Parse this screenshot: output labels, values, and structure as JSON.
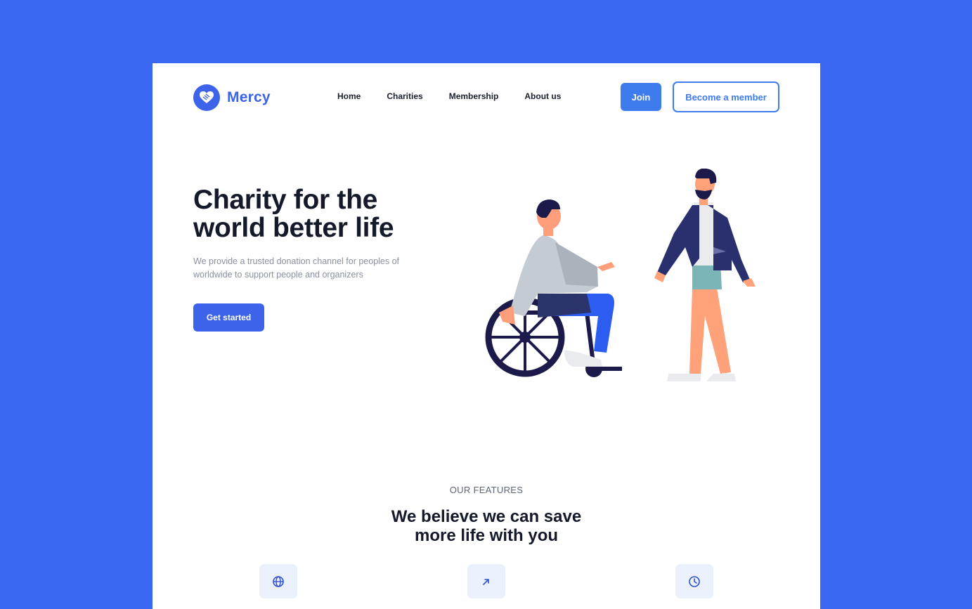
{
  "brand": {
    "name": "Mercy",
    "accent": "#3D63EA",
    "background": "#3A67F2"
  },
  "nav": {
    "items": [
      {
        "label": "Home"
      },
      {
        "label": "Charities"
      },
      {
        "label": "Membership"
      },
      {
        "label": "About us"
      }
    ]
  },
  "header": {
    "join_label": "Join",
    "member_label": "Become a member"
  },
  "hero": {
    "title": "Charity for the world better life",
    "subtitle": "We provide a trusted donation channel for peoples of worldwide to support people and organizers",
    "cta_label": "Get started"
  },
  "features": {
    "eyebrow": "OUR FEATURES",
    "title": "We believe we can save more life with you",
    "icons": [
      "globe-icon",
      "arrow-up-right-icon",
      "clock-icon"
    ]
  }
}
